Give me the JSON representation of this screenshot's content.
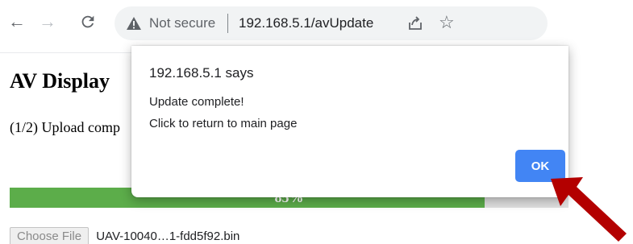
{
  "browser": {
    "nav": {
      "back_icon": "arrow-left-icon",
      "forward_icon": "arrow-right-icon",
      "reload_icon": "reload-icon"
    },
    "omnibox": {
      "security_label": "Not secure",
      "url": "192.168.5.1/avUpdate",
      "share_icon": "share-icon",
      "bookmark_icon": "star-icon"
    }
  },
  "page": {
    "title": "AV Display",
    "status_text": "(1/2) Upload comp",
    "progress": {
      "percent": 85,
      "label": "85%",
      "fill_color": "#5cad4a"
    },
    "file_input": {
      "button_label": "Choose File",
      "file_name": "UAV-10040…1-fdd5f92.bin"
    }
  },
  "dialog": {
    "title": "192.168.5.1 says",
    "message_lines": [
      "Update complete!",
      "Click to return to main page"
    ],
    "ok_label": "OK",
    "ok_color": "#4285f4"
  },
  "annotation": {
    "arrow_color": "#b30000"
  }
}
